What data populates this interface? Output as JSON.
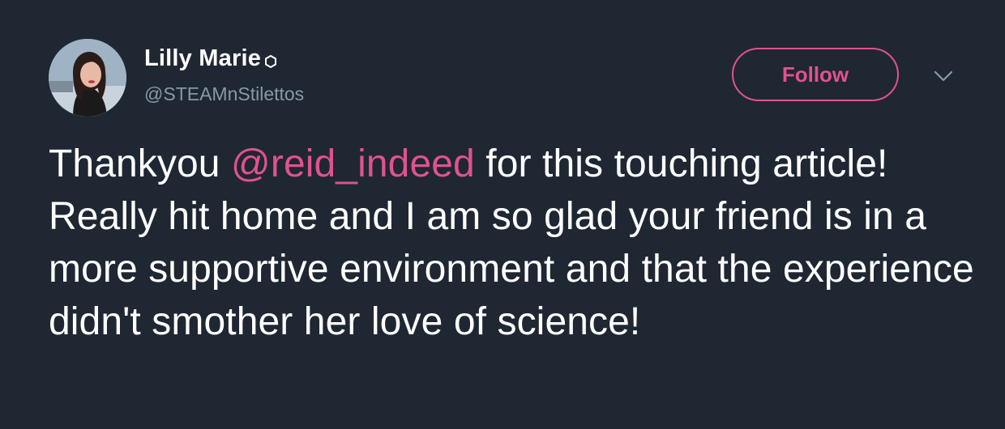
{
  "user": {
    "display_name": "Lilly Marie",
    "handle": "@STEAMnStilettos",
    "badge_icon": "hexagon-badge-icon",
    "avatar_icon": "profile-photo"
  },
  "actions": {
    "follow_label": "Follow",
    "menu_icon": "chevron-down-icon"
  },
  "tweet": {
    "text_before": "Thankyou ",
    "mention": "@reid_indeed",
    "text_after": " for this touching article! Really hit home and I am so glad your friend is in a more supportive environment and that the experience didn't smother her love of science!"
  },
  "colors": {
    "background": "#1f2733",
    "accent": "#e0528f",
    "secondary_text": "#8899a6",
    "primary_text": "#ffffff"
  }
}
